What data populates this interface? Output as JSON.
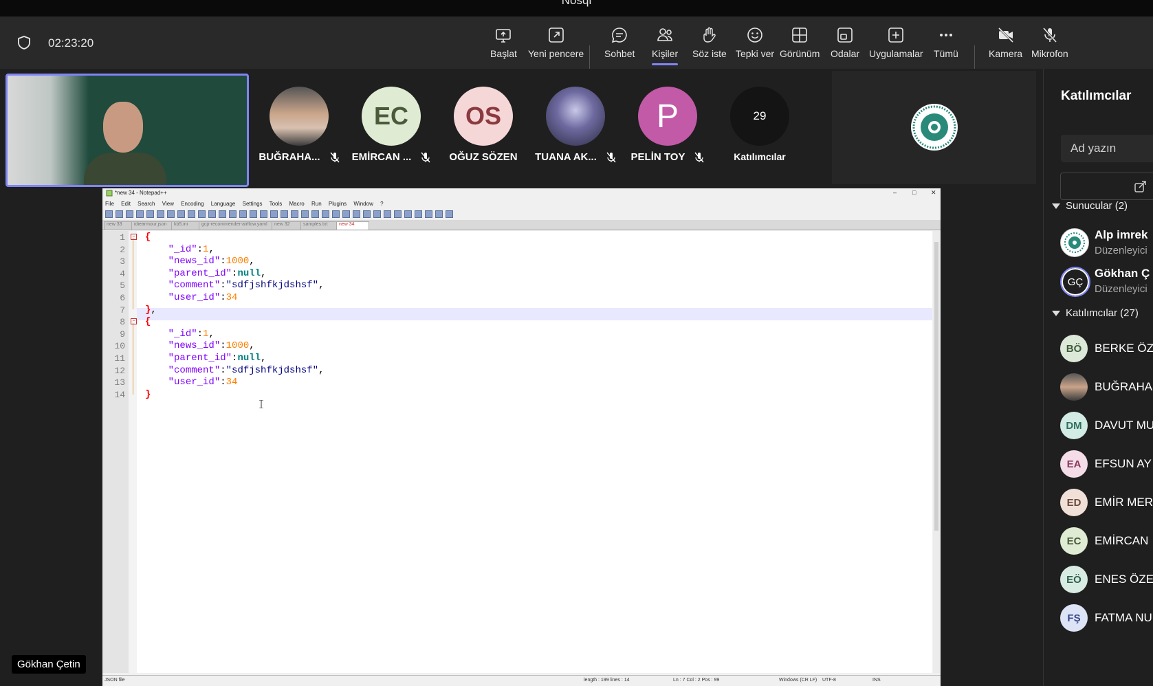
{
  "window": {
    "title": "Nosql"
  },
  "meeting": {
    "timer": "02:23:20",
    "toolbar": [
      {
        "label": "Başlat",
        "icon": "share-screen-icon"
      },
      {
        "label": "Yeni pencere",
        "icon": "new-window-icon"
      },
      {
        "label": "Sohbet",
        "icon": "chat-icon"
      },
      {
        "label": "Kişiler",
        "icon": "people-icon"
      },
      {
        "label": "Söz iste",
        "icon": "raise-hand-icon"
      },
      {
        "label": "Tepki ver",
        "icon": "emoji-icon"
      },
      {
        "label": "Görünüm",
        "icon": "view-grid-icon"
      },
      {
        "label": "Odalar",
        "icon": "rooms-icon"
      },
      {
        "label": "Uygulamalar",
        "icon": "apps-plus-icon"
      },
      {
        "label": "Tümü",
        "icon": "more-icon"
      },
      {
        "label": "Kamera",
        "icon": "camera-off-icon"
      },
      {
        "label": "Mikrofon",
        "icon": "mic-off-icon"
      }
    ],
    "active_tab": "Kişiler",
    "presenter_name": "Gökhan Çetin",
    "gallery": [
      {
        "name": "BUĞRAHA...",
        "initials": "",
        "bg": "#9a9a9a",
        "color": "#ffffff",
        "muted": true
      },
      {
        "name": "EMİRCAN ...",
        "initials": "EC",
        "bg": "#e0ebd3",
        "color": "#4a5a3a",
        "muted": true
      },
      {
        "name": "OĞUZ SÖZEN",
        "initials": "OS",
        "bg": "#f6d7d8",
        "color": "#8b3a3f",
        "muted": false
      },
      {
        "name": "TUANA AK...",
        "initials": "",
        "bg": "#6e6aa0",
        "color": "#ffffff",
        "muted": true
      },
      {
        "name": "PELİN TOY",
        "initials": "P",
        "bg": "#c25aa8",
        "color": "#ffffff",
        "muted": true
      },
      {
        "name": "Katılımcılar",
        "initials": "29",
        "bg": "#141414",
        "color": "#ffffff",
        "muted": false
      }
    ]
  },
  "panel": {
    "title": "Katılımcılar",
    "search_placeholder": "Ad yazın",
    "presenters_header": "Sunucular (2)",
    "presenters": [
      {
        "name": "Alp imrek",
        "role": "Düzenleyici",
        "initials": "",
        "bg": "#ffffff",
        "color": "#2a8a7a"
      },
      {
        "name": "Gökhan Ç",
        "role": "Düzenleyici",
        "initials": "GÇ",
        "bg": "#1f1f1f",
        "color": "#ffffff"
      }
    ],
    "attendees_header": "Katılımcılar (27)",
    "attendees": [
      {
        "name": "BERKE ÖZ",
        "initials": "BÖ",
        "bg": "#dce8d8",
        "color": "#3d5a3a"
      },
      {
        "name": "BUĞRAHA",
        "initials": "",
        "bg": "#9a9a9a",
        "color": "#ffffff"
      },
      {
        "name": "DAVUT MU",
        "initials": "DM",
        "bg": "#d2ebe4",
        "color": "#2f6f5e"
      },
      {
        "name": "EFSUN AY",
        "initials": "EA",
        "bg": "#f5dde8",
        "color": "#8b3a5f"
      },
      {
        "name": "EMİR MER",
        "initials": "ED",
        "bg": "#f1e0d8",
        "color": "#6a4a3a"
      },
      {
        "name": "EMİRCAN",
        "initials": "EC",
        "bg": "#e0ebd3",
        "color": "#4a5a3a"
      },
      {
        "name": "ENES ÖZE",
        "initials": "EÖ",
        "bg": "#d8ece4",
        "color": "#2f5f4e"
      },
      {
        "name": "FATMA NU",
        "initials": "FŞ",
        "bg": "#dde4f6",
        "color": "#3a4a8b"
      }
    ]
  },
  "notepad": {
    "title": "*new 34 - Notepad++",
    "menu": [
      "File",
      "Edit",
      "Search",
      "View",
      "Encoding",
      "Language",
      "Settings",
      "Tools",
      "Macro",
      "Run",
      "Plugins",
      "Window",
      "?"
    ],
    "tabs": [
      "new 33",
      "idiearmour.json",
      "kb5.ini",
      "gcp-recommender-airflow.yaml",
      "new 32",
      "samples.txt",
      "new 34"
    ],
    "active_tab": "new 34",
    "lines": [
      "{",
      "    \"_id\":1,",
      "    \"news_id\":1000,",
      "    \"parent_id\":null,",
      "    \"comment\":\"sdfjshfkjdshsf\",",
      "    \"user_id\":34",
      "},",
      "{",
      "    \"_id\":1,",
      "    \"news_id\":1000,",
      "    \"parent_id\":null,",
      "    \"comment\":\"sdfjshfkjdshsf\",",
      "    \"user_id\":34",
      "}"
    ],
    "status": {
      "filetype": "JSON file",
      "length": "length : 199   lines : 14",
      "position": "Ln : 7   Col : 2   Pos : 99",
      "eol": "Windows (CR LF)",
      "encoding": "UTF-8",
      "mode": "INS"
    }
  }
}
